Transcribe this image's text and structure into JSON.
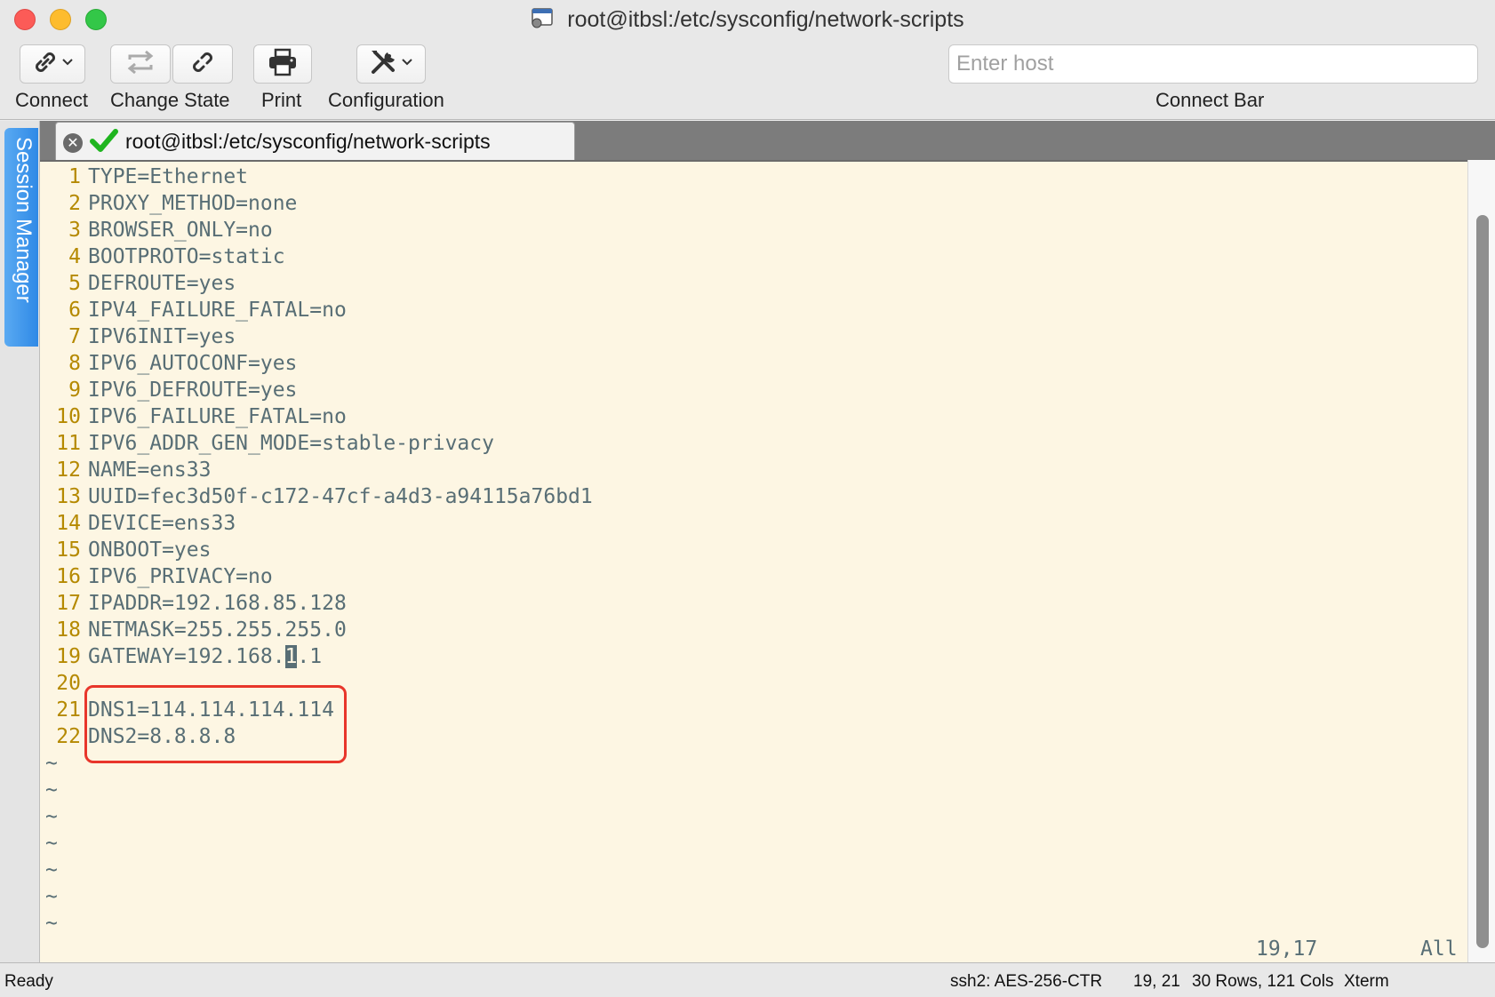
{
  "window": {
    "title": "root@itbsl:/etc/sysconfig/network-scripts"
  },
  "toolbar": {
    "connect_label": "Connect",
    "change_state_label": "Change State",
    "print_label": "Print",
    "configuration_label": "Configuration",
    "host_placeholder": "Enter host",
    "connect_bar_label": "Connect Bar"
  },
  "sidebar": {
    "session_manager_label": "Session Manager"
  },
  "tab": {
    "title": "root@itbsl:/etc/sysconfig/network-scripts",
    "close_glyph": "✕",
    "connected": true
  },
  "editor": {
    "lines": [
      {
        "num": "1",
        "text": "TYPE=Ethernet"
      },
      {
        "num": "2",
        "text": "PROXY_METHOD=none"
      },
      {
        "num": "3",
        "text": "BROWSER_ONLY=no"
      },
      {
        "num": "4",
        "text": "BOOTPROTO=static"
      },
      {
        "num": "5",
        "text": "DEFROUTE=yes"
      },
      {
        "num": "6",
        "text": "IPV4_FAILURE_FATAL=no"
      },
      {
        "num": "7",
        "text": "IPV6INIT=yes"
      },
      {
        "num": "8",
        "text": "IPV6_AUTOCONF=yes"
      },
      {
        "num": "9",
        "text": "IPV6_DEFROUTE=yes"
      },
      {
        "num": "10",
        "text": "IPV6_FAILURE_FATAL=no"
      },
      {
        "num": "11",
        "text": "IPV6_ADDR_GEN_MODE=stable-privacy"
      },
      {
        "num": "12",
        "text": "NAME=ens33"
      },
      {
        "num": "13",
        "text": "UUID=fec3d50f-c172-47cf-a4d3-a94115a76bd1"
      },
      {
        "num": "14",
        "text": "DEVICE=ens33"
      },
      {
        "num": "15",
        "text": "ONBOOT=yes"
      },
      {
        "num": "16",
        "text": "IPV6_PRIVACY=no"
      },
      {
        "num": "17",
        "text": "IPADDR=192.168.85.128"
      },
      {
        "num": "18",
        "text": "NETMASK=255.255.255.0"
      },
      {
        "num": "19",
        "text_before": "GATEWAY=192.168.",
        "cursor_char": "1",
        "text_after": ".1"
      },
      {
        "num": "20",
        "text": ""
      },
      {
        "num": "21",
        "text": "DNS1=114.114.114.114"
      },
      {
        "num": "22",
        "text": "DNS2=8.8.8.8"
      }
    ],
    "tilde": "~",
    "tilde_rows": 7,
    "cursor_position": "19,17",
    "scroll_status": "All"
  },
  "statusbar": {
    "state": "Ready",
    "encryption": "ssh2: AES-256-CTR",
    "cursor": "19, 21",
    "size": "30 Rows, 121 Cols",
    "terminal_type": "Xterm"
  },
  "colors": {
    "terminal_bg": "#fdf6e3",
    "line_number": "#b58900",
    "text": "#586e75",
    "highlight_box": "#e8362b",
    "session_tab": "#3d93ea"
  }
}
